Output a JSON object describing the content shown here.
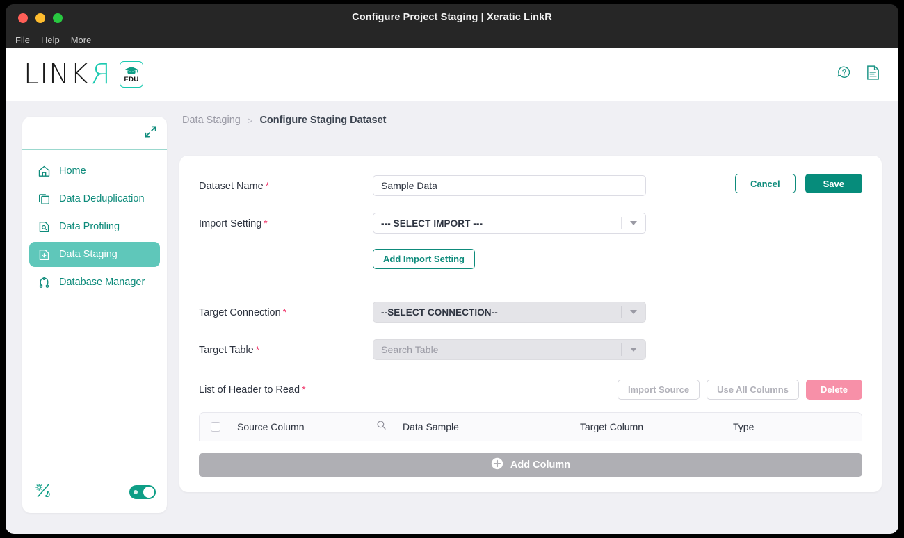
{
  "window": {
    "title": "Configure Project Staging | Xeratic LinkR",
    "menu": [
      "File",
      "Help",
      "More"
    ]
  },
  "header": {
    "logo_text": "LINK",
    "logo_r": "R",
    "edu_badge": "EDU",
    "icons": [
      {
        "name": "help-icon",
        "label": "Help"
      },
      {
        "name": "report-icon",
        "label": "Report"
      }
    ]
  },
  "sidebar": {
    "collapse_icon": "collapse-icon",
    "items": [
      {
        "label": "Home",
        "icon": "home-icon",
        "active": false
      },
      {
        "label": "Data Deduplication",
        "icon": "copy-icon",
        "active": false
      },
      {
        "label": "Data Profiling",
        "icon": "document-search-icon",
        "active": false
      },
      {
        "label": "Data Staging",
        "icon": "document-arrow-icon",
        "active": true
      },
      {
        "label": "Database Manager",
        "icon": "database-icon",
        "active": false
      }
    ],
    "footer": {
      "theme_icon": "theme-sun-moon-icon",
      "toggle_on": true
    }
  },
  "breadcrumb": {
    "parent": "Data Staging",
    "separator": ">",
    "current": "Configure Staging Dataset"
  },
  "form": {
    "dataset_name": {
      "label": "Dataset Name",
      "required": true,
      "value": "Sample Data",
      "placeholder": "Dataset Name"
    },
    "import_setting": {
      "label": "Import Setting",
      "required": true,
      "value": "--- SELECT IMPORT ---"
    },
    "add_import_setting_label": "Add Import Setting",
    "target_connection": {
      "label": "Target Connection",
      "required": true,
      "value": "--SELECT CONNECTION--",
      "disabled": true
    },
    "target_table": {
      "label": "Target Table",
      "required": true,
      "value": "Search Table",
      "disabled": true
    },
    "buttons": {
      "cancel": "Cancel",
      "save": "Save"
    }
  },
  "headers_section": {
    "label": "List of Header to Read",
    "required": true,
    "actions": [
      {
        "label": "Import Source",
        "state": "disabled"
      },
      {
        "label": "Use All Columns",
        "state": "disabled"
      },
      {
        "label": "Delete",
        "state": "danger"
      }
    ],
    "table": {
      "columns": [
        "Source Column",
        "Data Sample",
        "Target Column",
        "Type"
      ],
      "rows": []
    },
    "add_column_label": "Add Column"
  },
  "colors": {
    "brand_teal": "#0E8B7B",
    "logo_teal": "#19C9B0",
    "active_nav": "#5FC7BA",
    "required_red": "#F0376B",
    "danger_pink": "#F790A8",
    "page_bg": "#F0F0F4"
  }
}
